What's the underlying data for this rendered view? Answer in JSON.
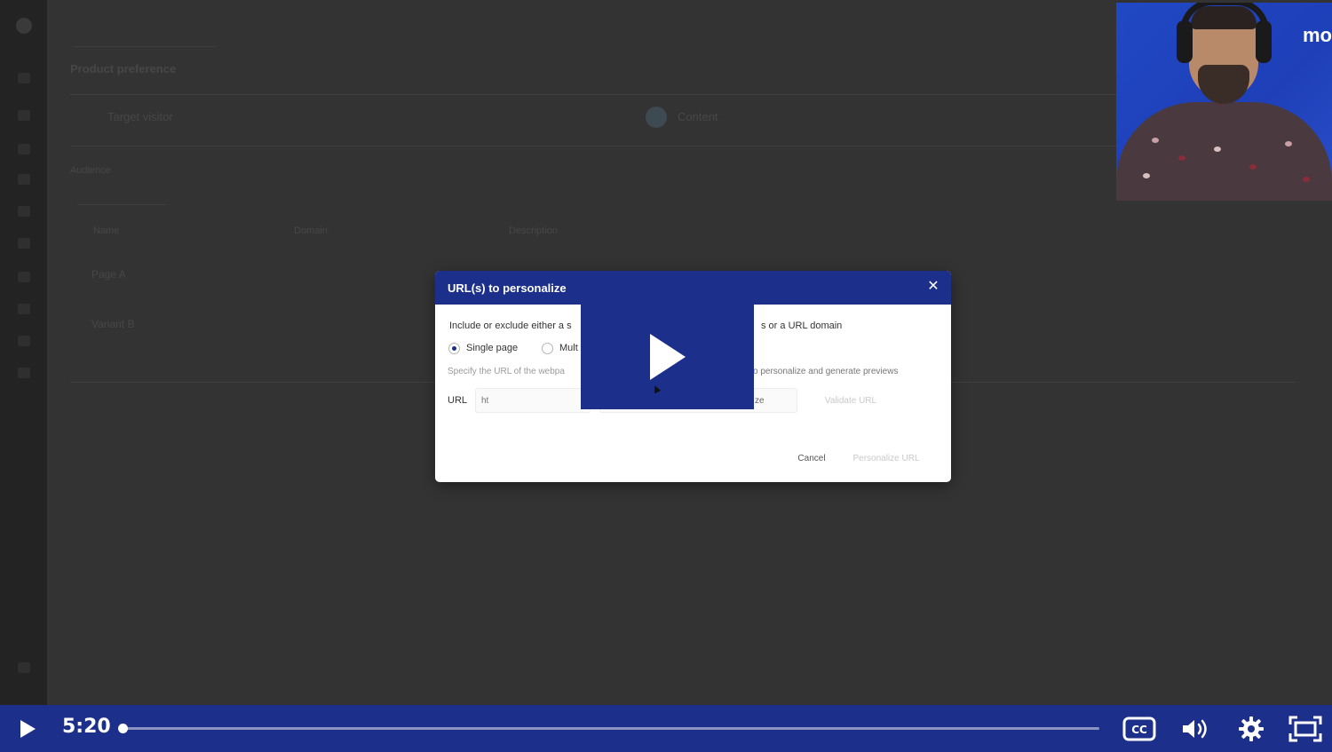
{
  "background_app": {
    "section_title": "Product preference",
    "option_one": "Target visitor",
    "option_two": "Content",
    "sub_heading": "Audience",
    "table_headers": [
      "Name",
      "Domain",
      "Description"
    ],
    "rows": [
      "Page A",
      "Variant B"
    ]
  },
  "webcam": {
    "brand_text": "mo"
  },
  "modal": {
    "title": "URL(s) to personalize",
    "close_icon": "close-icon",
    "description_start": "Include or exclude either a s",
    "description_end": "s or a URL domain",
    "radio_single": "Single page",
    "radio_multi": "Mult",
    "hint_start": "Specify the URL of the webpa",
    "hint_end": "o personalize and generate previews",
    "url_label": "URL",
    "url_placeholder": "ht",
    "mode_text": "ze",
    "validate_label": "Validate URL",
    "cancel_label": "Cancel",
    "personalize_label": "Personalize URL"
  },
  "player": {
    "time": "5:20",
    "progress": 0.002,
    "icons": {
      "play": "play-icon",
      "cc": "closed-captions-icon",
      "volume": "volume-icon",
      "settings": "gear-icon",
      "fullscreen": "fullscreen-icon"
    },
    "accent_color": "#1c2f8a"
  }
}
